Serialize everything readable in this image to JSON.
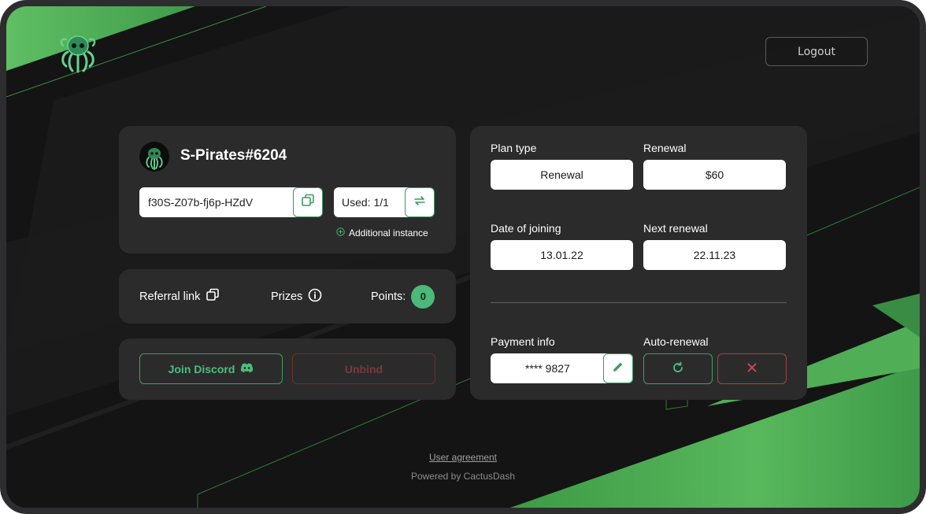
{
  "header": {
    "logout_label": "Logout"
  },
  "account": {
    "username": "S-Pirates#6204",
    "license_key": "f30S-Z07b-fj6p-HZdV",
    "used_label": "Used: 1/1",
    "additional_instance_label": "Additional instance"
  },
  "referral": {
    "referral_link_label": "Referral link",
    "prizes_label": "Prizes",
    "points_label": "Points:",
    "points_value": "0"
  },
  "actions": {
    "join_discord_label": "Join Discord",
    "unbind_label": "Unbind"
  },
  "plan": {
    "plan_type_label": "Plan type",
    "plan_type_value": "Renewal",
    "renewal_label": "Renewal",
    "renewal_value": "$60",
    "date_joining_label": "Date of joining",
    "date_joining_value": "13.01.22",
    "next_renewal_label": "Next renewal",
    "next_renewal_value": "22.11.23",
    "payment_info_label": "Payment info",
    "payment_info_value": "**** 9827",
    "auto_renewal_label": "Auto-renewal"
  },
  "footer": {
    "user_agreement_label": "User agreement",
    "powered_by": "Powered by CactusDash"
  },
  "icons": {
    "logo": "octopus-logo-icon",
    "copy": "copy-icon",
    "swap": "swap-arrows-icon",
    "add": "plus-circle-icon",
    "info": "info-icon",
    "discord": "discord-icon",
    "edit": "pencil-icon",
    "renew": "refresh-icon",
    "cancel": "close-icon"
  },
  "colors": {
    "background": "#151515",
    "card": "#2b2b2b",
    "accent_green": "#4cb87a",
    "danger_red": "#c04545"
  }
}
